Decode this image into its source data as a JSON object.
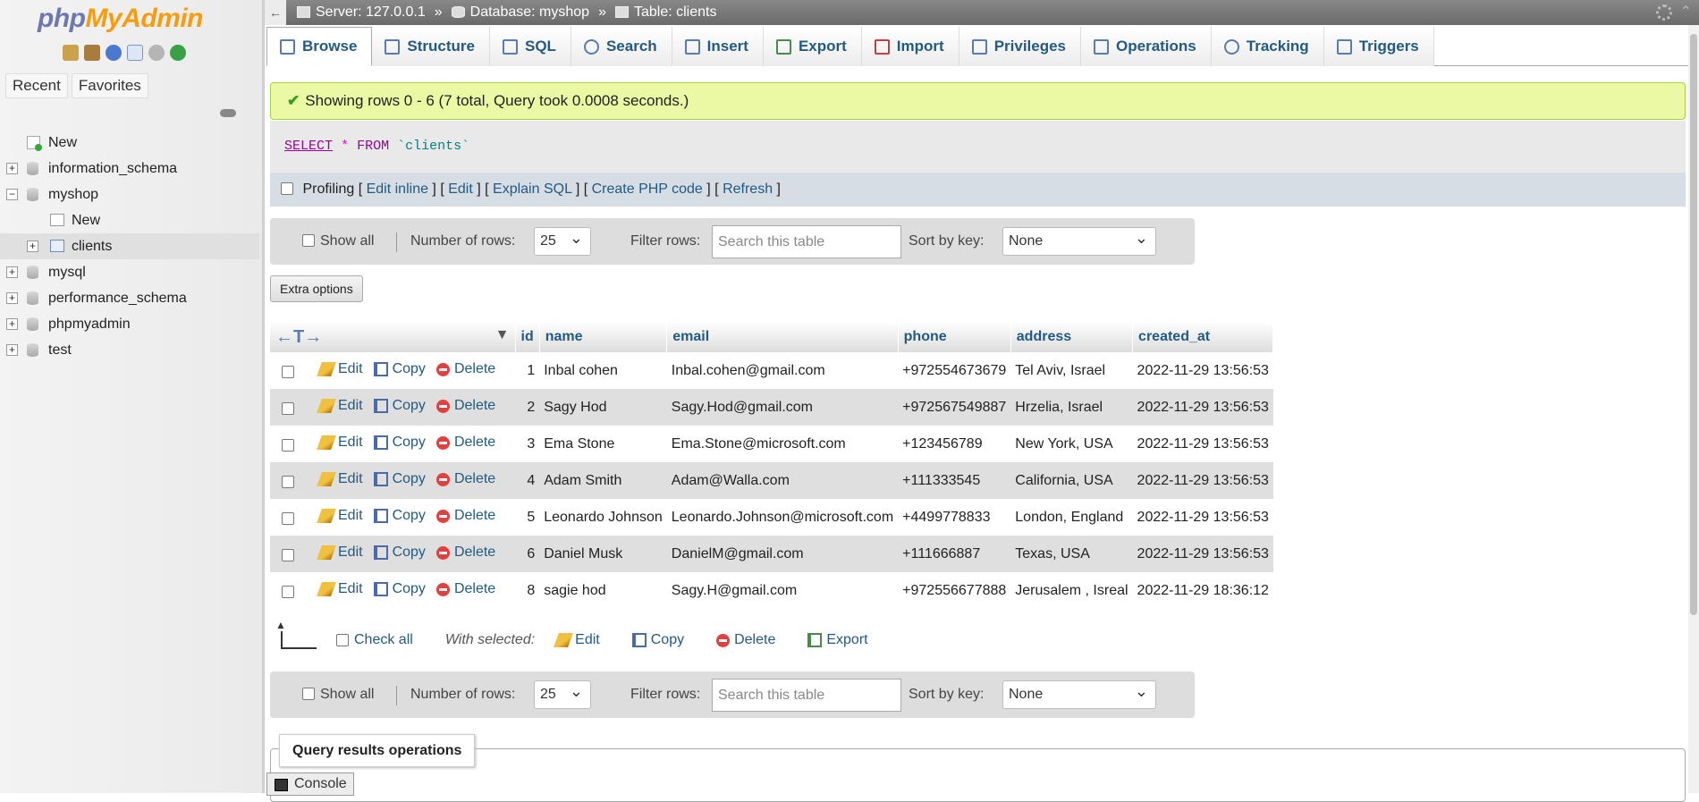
{
  "nav": {
    "logo_php": "php",
    "logo_ma": "MyAdmin",
    "tab_recent": "Recent",
    "tab_favorites": "Favorites",
    "tree": {
      "new": "New",
      "information_schema": "information_schema",
      "myshop": "myshop",
      "myshop_new": "New",
      "clients": "clients",
      "mysql": "mysql",
      "performance_schema": "performance_schema",
      "phpmyadmin": "phpmyadmin",
      "test": "test"
    }
  },
  "breadcrumb": {
    "server": "Server: 127.0.0.1",
    "database": "Database: myshop",
    "table": "Table: clients",
    "sep": "»"
  },
  "tabs": [
    "Browse",
    "Structure",
    "SQL",
    "Search",
    "Insert",
    "Export",
    "Import",
    "Privileges",
    "Operations",
    "Tracking",
    "Triggers"
  ],
  "success": "Showing rows 0 - 6 (7 total, Query took 0.0008 seconds.)",
  "sql": {
    "select": "SELECT",
    "star": "*",
    "from": "FROM",
    "table": "`clients`"
  },
  "profiling": {
    "label": "Profiling",
    "links": [
      "Edit inline",
      "Edit",
      "Explain SQL",
      "Create PHP code",
      "Refresh"
    ]
  },
  "navpanel": {
    "show_all": "Show all",
    "number_of_rows": "Number of rows:",
    "rows_value": "25",
    "filter_rows": "Filter rows:",
    "search_placeholder": "Search this table",
    "sort_by_key": "Sort by key:",
    "sort_value": "None"
  },
  "extra_options": "Extra options",
  "table": {
    "headers": [
      "id",
      "name",
      "email",
      "phone",
      "address",
      "created_at"
    ],
    "actions": {
      "edit": "Edit",
      "copy": "Copy",
      "delete": "Delete"
    },
    "rows": [
      [
        "1",
        "Inbal cohen",
        "Inbal.cohen@gmail.com",
        "+972554673679",
        "Tel Aviv, Israel",
        "2022-11-29 13:56:53"
      ],
      [
        "2",
        "Sagy Hod",
        "Sagy.Hod@gmail.com",
        "+972567549887",
        "Hrzelia, Israel",
        "2022-11-29 13:56:53"
      ],
      [
        "3",
        "Ema Stone",
        "Ema.Stone@microsoft.com",
        "+123456789",
        "New York, USA",
        "2022-11-29 13:56:53"
      ],
      [
        "4",
        "Adam Smith",
        "Adam@Walla.com",
        "+111333545",
        "California, USA",
        "2022-11-29 13:56:53"
      ],
      [
        "5",
        "Leonardo Johnson",
        "Leonardo.Johnson@microsoft.com",
        "+4499778833",
        "London, England",
        "2022-11-29 13:56:53"
      ],
      [
        "6",
        "Daniel Musk",
        "DanielM@gmail.com",
        "+111666887",
        "Texas, USA",
        "2022-11-29 13:56:53"
      ],
      [
        "8",
        "sagie hod",
        "Sagy.H@gmail.com",
        "+972556677888",
        "Jerusalem , Isreal",
        "2022-11-29 18:36:12"
      ]
    ]
  },
  "bulk": {
    "check_all": "Check all",
    "with_selected": "With selected:",
    "edit": "Edit",
    "copy": "Copy",
    "delete": "Delete",
    "export": "Export"
  },
  "query_results_operations": "Query results operations",
  "console": "Console"
}
